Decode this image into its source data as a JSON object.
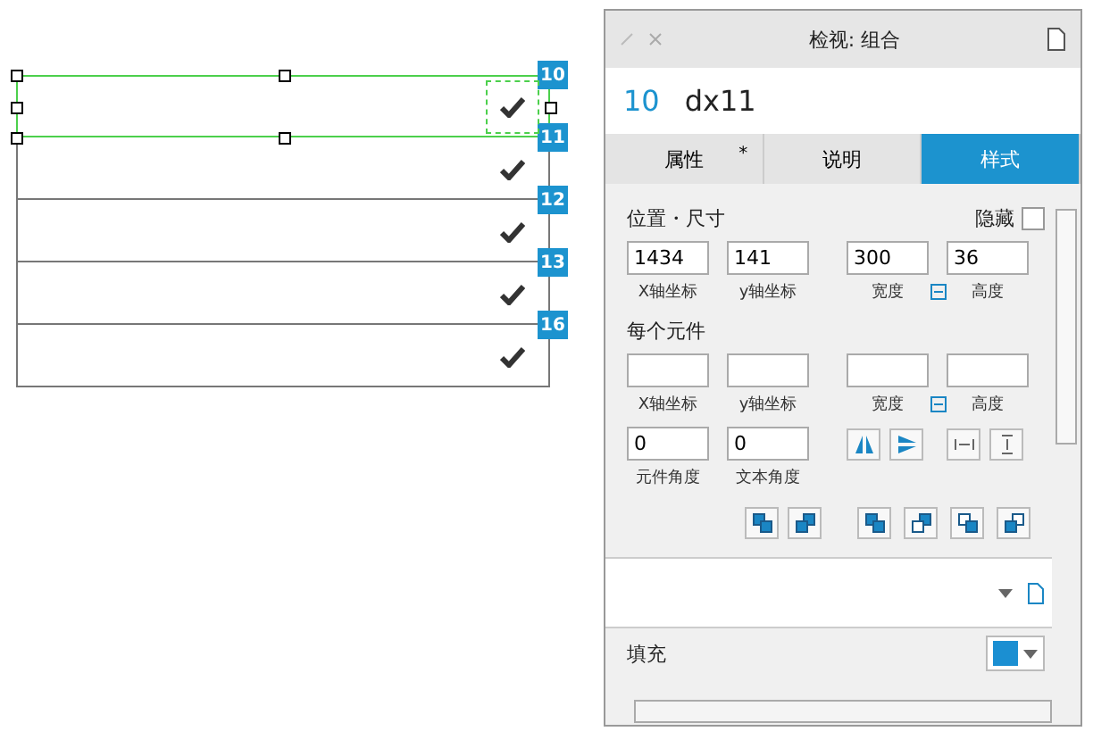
{
  "canvas": {
    "rows": [
      {
        "badge": "10",
        "selected": true
      },
      {
        "badge": "11",
        "selected": false
      },
      {
        "badge": "12",
        "selected": false
      },
      {
        "badge": "13",
        "selected": false
      },
      {
        "badge": "16",
        "selected": false
      }
    ]
  },
  "panel": {
    "title": "检视: 组合",
    "item_number": "10",
    "item_name": "dx11",
    "tabs": [
      {
        "label": "属性",
        "mark": "*",
        "selected": false
      },
      {
        "label": "说明",
        "selected": false
      },
      {
        "label": "样式",
        "selected": true
      }
    ],
    "section_title": "位置・尺寸",
    "hide": {
      "label": "隐藏",
      "checked": false
    },
    "position_fields": [
      {
        "value": "1434",
        "label": "X轴坐标"
      },
      {
        "value": "141",
        "label": "y轴坐标"
      },
      {
        "value": "300",
        "label": "宽度"
      },
      {
        "value": "36",
        "label": "高度"
      }
    ],
    "per_item_title": "每个元件",
    "per_item_fields": [
      {
        "label": "X轴坐标"
      },
      {
        "label": "y轴坐标"
      },
      {
        "label": "宽度"
      },
      {
        "label": "高度"
      }
    ],
    "angle_fields": [
      {
        "value": "0",
        "label": "元件角度"
      },
      {
        "value": "0",
        "label": "文本角度"
      }
    ],
    "fill": {
      "label": "填充",
      "color": "#1b8fd2"
    }
  }
}
